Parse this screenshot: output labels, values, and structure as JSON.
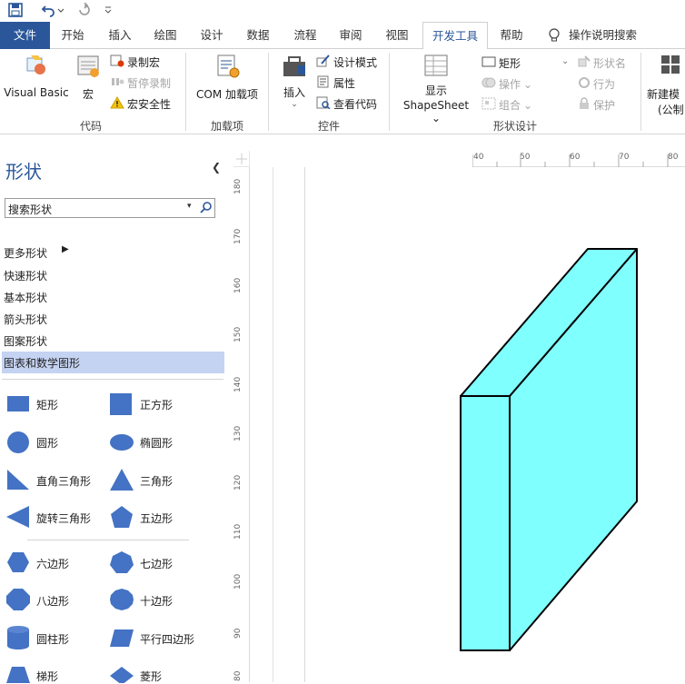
{
  "qat": {
    "save": "save-icon",
    "undo": "undo-icon",
    "redo": "redo-icon",
    "customize": "customize-icon"
  },
  "tabs": [
    {
      "label": "文件"
    },
    {
      "label": "开始"
    },
    {
      "label": "插入"
    },
    {
      "label": "绘图"
    },
    {
      "label": "设计"
    },
    {
      "label": "数据"
    },
    {
      "label": "流程"
    },
    {
      "label": "审阅"
    },
    {
      "label": "视图"
    },
    {
      "label": "开发工具"
    },
    {
      "label": "帮助"
    }
  ],
  "tell_me": "操作说明搜索",
  "ribbon": {
    "code": {
      "label": "代码",
      "visual_basic": "Visual Basic",
      "macros": "宏",
      "record_macro": "录制宏",
      "pause_recording": "暂停录制",
      "macro_security": "宏安全性"
    },
    "addins": {
      "label": "加载项",
      "com_addins": "COM 加载项"
    },
    "controls": {
      "label": "控件",
      "insert": "插入",
      "design_mode": "设计模式",
      "properties": "属性",
      "view_code": "查看代码"
    },
    "shape_design": {
      "label": "形状设计",
      "show_shapesheet_1": "显示",
      "show_shapesheet_2": "ShapeSheet",
      "rectangle": "矩形",
      "operations": "操作",
      "group": "组合",
      "shape_name": "形状名",
      "behavior": "行为",
      "protection": "保护"
    },
    "new_template": {
      "line1": "新建模",
      "line2": "(公制"
    }
  },
  "shapes_panel": {
    "title": "形状",
    "search_placeholder": "搜索形状",
    "menu": [
      "更多形状",
      "快速形状",
      "基本形状",
      "箭头形状",
      "图案形状",
      "图表和数学图形"
    ],
    "shapes": [
      {
        "label": "矩形"
      },
      {
        "label": "正方形"
      },
      {
        "label": "圆形"
      },
      {
        "label": "椭圆形"
      },
      {
        "label": "直角三角形"
      },
      {
        "label": "三角形"
      },
      {
        "label": "旋转三角形"
      },
      {
        "label": "五边形"
      },
      {
        "label": "六边形"
      },
      {
        "label": "七边形"
      },
      {
        "label": "八边形"
      },
      {
        "label": "十边形"
      },
      {
        "label": "圆柱形"
      },
      {
        "label": "平行四边形"
      },
      {
        "label": "梯形"
      },
      {
        "label": "菱形"
      }
    ],
    "shape_color": "#4472c4"
  },
  "rulers": {
    "horizontal": [
      "40",
      "50",
      "60",
      "70",
      "80"
    ],
    "vertical": [
      "180",
      "170",
      "160",
      "150",
      "140",
      "130",
      "120",
      "110",
      "100",
      "90",
      "80"
    ]
  },
  "canvas": {
    "block_fill": "#80ffff",
    "block_stroke": "#000000"
  }
}
